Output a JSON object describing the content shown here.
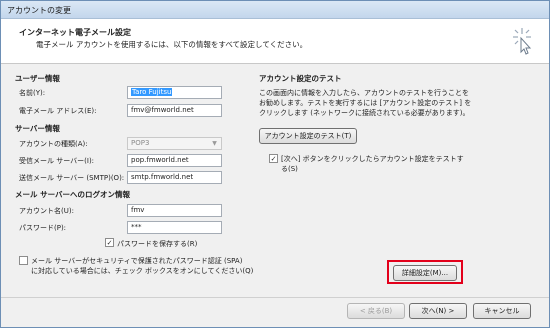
{
  "window": {
    "title": "アカウントの変更"
  },
  "header": {
    "title": "インターネット電子メール設定",
    "subtitle": "電子メール アカウントを使用するには、以下の情報をすべて設定してください。",
    "icon": "sparkle-cursor-icon"
  },
  "user_info": {
    "section": "ユーザー情報",
    "name_label": "名前(Y):",
    "name_value": "Taro Fujitsu",
    "email_label": "電子メール アドレス(E):",
    "email_value": "fmv@fmworld.net"
  },
  "server_info": {
    "section": "サーバー情報",
    "account_type_label": "アカウントの種類(A):",
    "account_type_value": "POP3",
    "incoming_label": "受信メール サーバー(I):",
    "incoming_value": "pop.fmworld.net",
    "outgoing_label": "送信メール サーバー (SMTP)(O):",
    "outgoing_value": "smtp.fmworld.net"
  },
  "logon_info": {
    "section": "メール サーバーへのログオン情報",
    "account_label": "アカウント名(U):",
    "account_value": "fmv",
    "password_label": "パスワード(P):",
    "password_value": "***",
    "save_password_label": "パスワードを保存する(R)",
    "save_password_checked": true,
    "spa_label_line1": "メール サーバーがセキュリティで保護されたパスワード認証 (SPA)",
    "spa_label_line2": "に対応している場合には、チェック ボックスをオンにしてください(Q)",
    "spa_checked": false
  },
  "test": {
    "section": "アカウント設定のテスト",
    "desc_line1": "この画面内に情報を入力したら、アカウントのテストを行うことを",
    "desc_line2": "お勧めします。テストを実行するには [アカウント設定のテスト] を",
    "desc_line3": "クリックします (ネットワークに接続されている必要があります)。",
    "test_button": "アカウント設定のテスト(T)",
    "auto_test_line1": "[次へ] ボタンをクリックしたらアカウント設定をテストす",
    "auto_test_line2": "る(S)",
    "auto_test_checked": true,
    "advanced_button": "詳細設定(M)..."
  },
  "footer": {
    "back_button": "< 戻る(B)",
    "next_button": "次へ(N) >",
    "cancel_button": "キャンセル"
  },
  "colors": {
    "highlight": "#e3001b",
    "selection": "#3399ff"
  }
}
